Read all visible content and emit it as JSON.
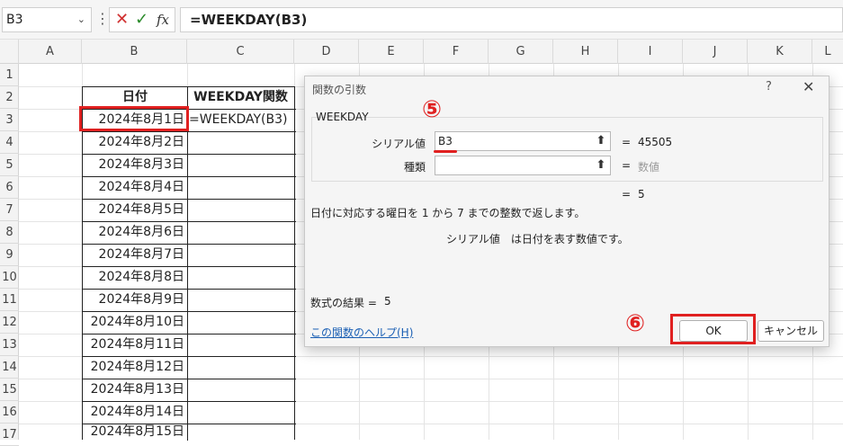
{
  "formula_bar": {
    "name_box": "B3",
    "chevron": "⌄",
    "dots": "⋮",
    "cancel": "✕",
    "enter": "✓",
    "fx": "fx",
    "formula": "=WEEKDAY(B3)"
  },
  "columns": [
    "A",
    "B",
    "C",
    "D",
    "E",
    "F",
    "G",
    "H",
    "I",
    "J",
    "K",
    "L"
  ],
  "rows": [
    "1",
    "2",
    "3",
    "4",
    "5",
    "6",
    "7",
    "8",
    "9",
    "10",
    "11",
    "12",
    "13",
    "14",
    "15",
    "16",
    "17"
  ],
  "sheet": {
    "header_date": "日付",
    "header_func": "WEEKDAY関数",
    "c3_formula": "=WEEKDAY(B3)",
    "dates": [
      "2024年8月1日",
      "2024年8月2日",
      "2024年8月3日",
      "2024年8月4日",
      "2024年8月5日",
      "2024年8月6日",
      "2024年8月7日",
      "2024年8月8日",
      "2024年8月9日",
      "2024年8月10日",
      "2024年8月11日",
      "2024年8月12日",
      "2024年8月13日",
      "2024年8月14日",
      "2024年8月15日"
    ]
  },
  "dialog": {
    "title": "関数の引数",
    "help_q": "?",
    "close": "✕",
    "function_name": "WEEKDAY",
    "arg1_label": "シリアル値",
    "arg1_value": "B3",
    "arg1_result": "45505",
    "arg2_label": "種類",
    "arg2_value": "",
    "arg2_result": "数値",
    "arg_btn": "⬆",
    "eq": "=",
    "overall_result": "5",
    "description": "日付に対応する曜日を 1 から 7 までの整数で返します。",
    "arg_description": "シリアル値　は日付を表す数値です。",
    "result_label": "数式の結果 =",
    "result_value": "5",
    "help_link": "この関数のヘルプ(H)",
    "ok": "OK",
    "cancel": "キャンセル"
  },
  "annotations": {
    "step5": "⑤",
    "step6": "⑥",
    "color": "#e02020"
  }
}
